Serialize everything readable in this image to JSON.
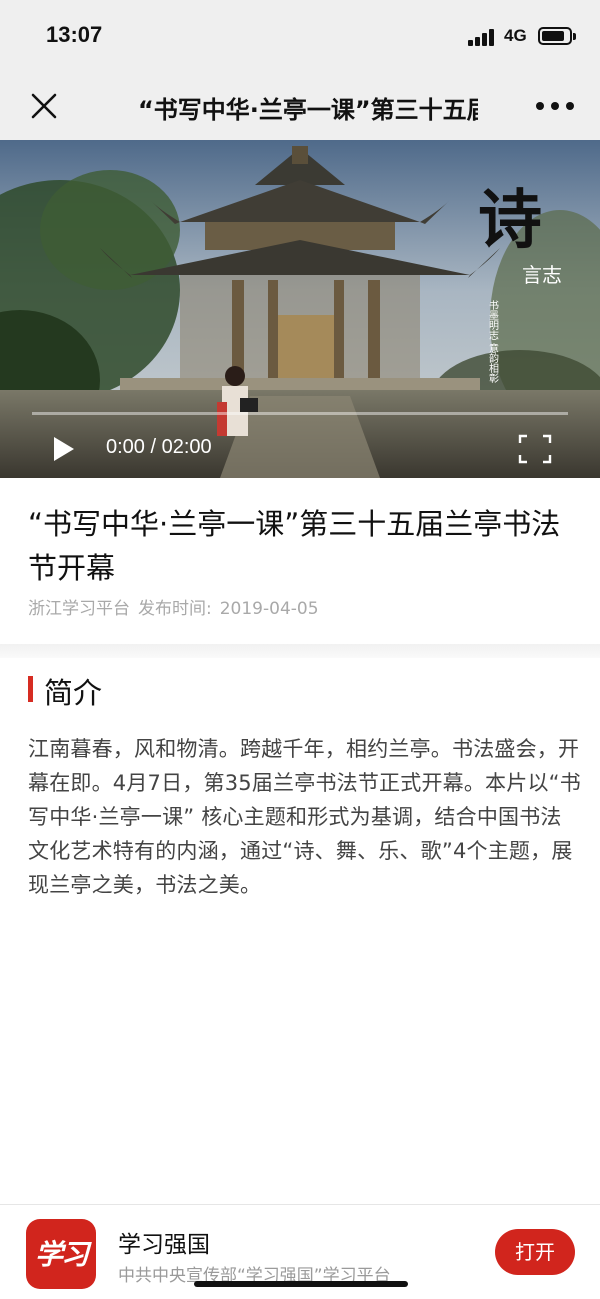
{
  "status_bar": {
    "time": "13:07",
    "network": "4G"
  },
  "nav": {
    "title": "“书写中华·兰亭一课”第三十五届兰亭书法节开幕",
    "close_icon": "close-icon",
    "more_icon": "more-icon"
  },
  "video": {
    "time_display": "0:00 / 02:00",
    "overlay_calligraphy": {
      "main_char": "诗",
      "subtitle": "言志",
      "vertical_text": "书墨明志 意韵相彰"
    },
    "progress": 0
  },
  "article": {
    "title": "“书写中华·兰亭一课”第三十五届兰亭书法节开幕",
    "source": "浙江学习平台",
    "publish_label": "发布时间:",
    "publish_date": "2019-04-05"
  },
  "intro": {
    "heading": "简介",
    "body": "江南暮春，风和物清。跨越千年，相约兰亭。书法盛会，开幕在即。4月7日，第35届兰亭书法节正式开幕。本片以“书写中华·兰亭一课” 核心主题和形式为基调，结合中国书法文化艺术特有的内涵，通过“诗、舞、乐、歌”4个主题，展现兰亭之美，书法之美。"
  },
  "app_banner": {
    "logo_text": "学习",
    "name": "学习强国",
    "description": "中共中央宣传部“学习强国”学习平台",
    "open_label": "打开"
  },
  "colors": {
    "accent": "#d1251d",
    "section_bar": "#d62c22",
    "nav_bg": "#efefef",
    "meta_text": "#a9a9a9"
  }
}
